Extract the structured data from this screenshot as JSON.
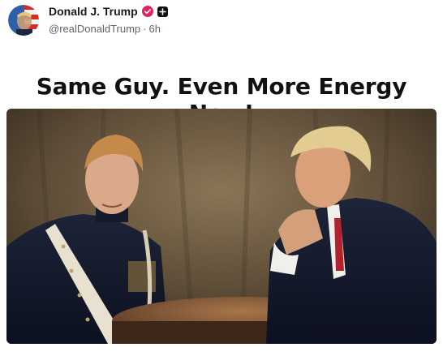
{
  "post": {
    "author": {
      "display_name": "Donald J. Trump",
      "handle": "@realDonaldTrump",
      "time_ago": "6h",
      "separator": "·",
      "verified_icon": "verified-badge-icon",
      "verified_color": "#e0245e",
      "follow_icon": "plus-icon"
    },
    "text": "Same Guy. Even More Energy Now!",
    "media": {
      "type": "image",
      "content": "two-person portrait at round table"
    }
  },
  "colors": {
    "background": "#ffffff",
    "name": "#1a1a1a",
    "meta": "#5f6670",
    "caption": "#111111"
  }
}
